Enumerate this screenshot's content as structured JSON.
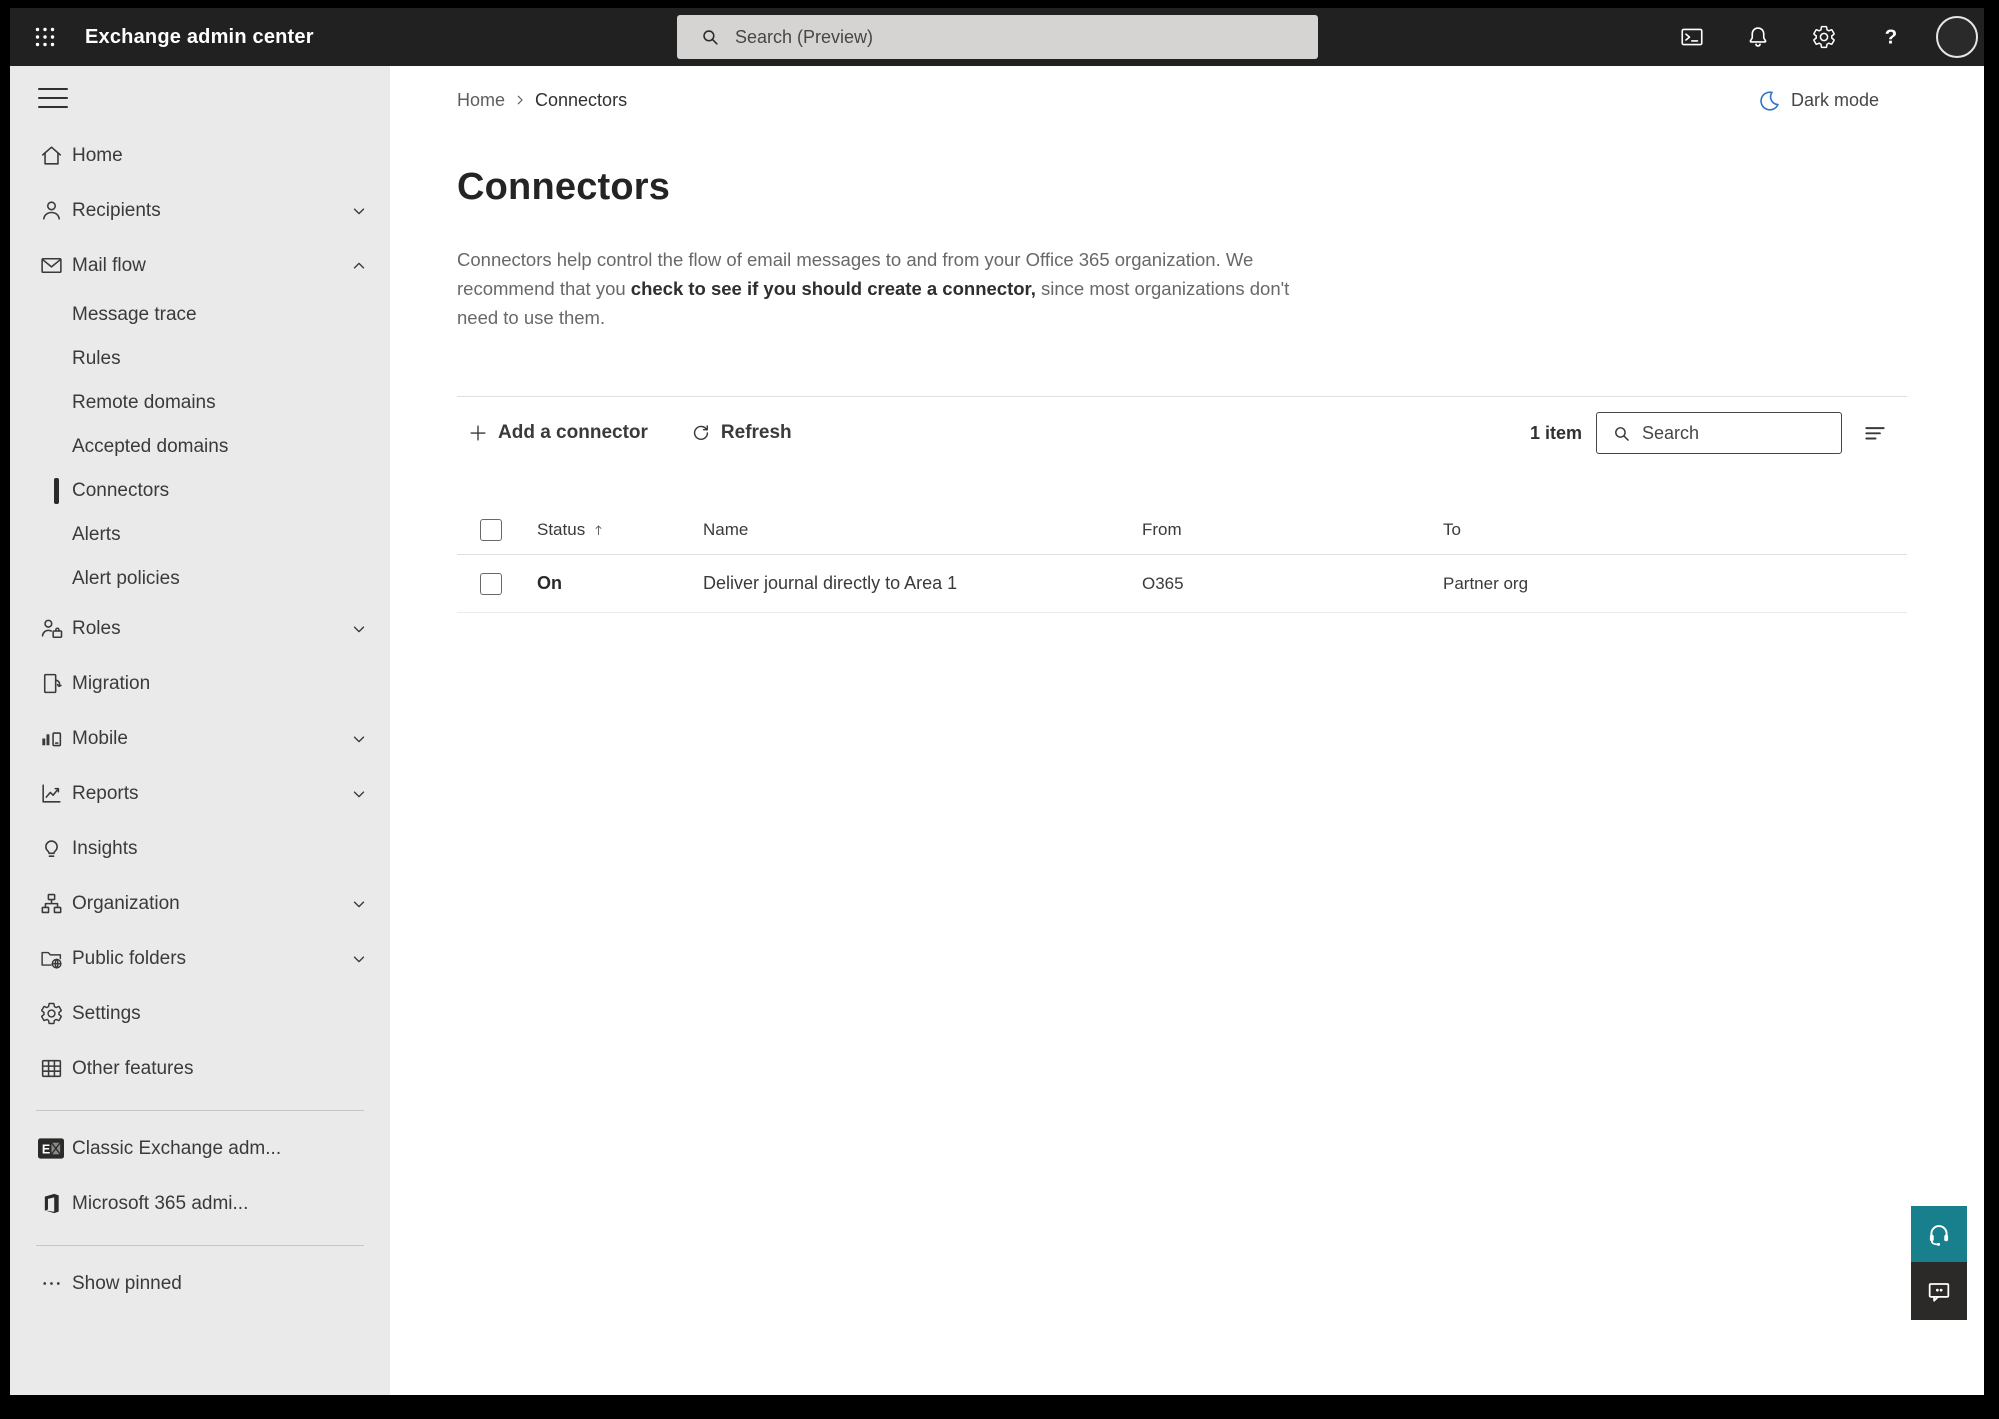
{
  "topbar": {
    "app_title": "Exchange admin center",
    "search_placeholder": "Search (Preview)",
    "icons": [
      "app-launcher",
      "powershell-terminal",
      "notifications-bell",
      "settings-gear",
      "help",
      "account-avatar"
    ]
  },
  "sidebar": {
    "items": [
      {
        "label": "Home",
        "icon": "home-icon"
      },
      {
        "label": "Recipients",
        "icon": "person-icon",
        "chevron": "down"
      },
      {
        "label": "Mail flow",
        "icon": "mail-icon",
        "chevron": "up",
        "expanded": true
      },
      {
        "label": "Message trace",
        "type": "sub"
      },
      {
        "label": "Rules",
        "type": "sub"
      },
      {
        "label": "Remote domains",
        "type": "sub"
      },
      {
        "label": "Accepted domains",
        "type": "sub"
      },
      {
        "label": "Connectors",
        "type": "sub",
        "selected": true
      },
      {
        "label": "Alerts",
        "type": "sub"
      },
      {
        "label": "Alert policies",
        "type": "sub"
      },
      {
        "label": "Roles",
        "icon": "roles-icon",
        "chevron": "down"
      },
      {
        "label": "Migration",
        "icon": "migration-icon"
      },
      {
        "label": "Mobile",
        "icon": "mobile-icon",
        "chevron": "down"
      },
      {
        "label": "Reports",
        "icon": "reports-icon",
        "chevron": "down"
      },
      {
        "label": "Insights",
        "icon": "insights-icon"
      },
      {
        "label": "Organization",
        "icon": "organization-icon",
        "chevron": "down"
      },
      {
        "label": "Public folders",
        "icon": "public-folders-icon",
        "chevron": "down"
      },
      {
        "label": "Settings",
        "icon": "settings-gear-icon"
      },
      {
        "label": "Other features",
        "icon": "other-features-icon"
      }
    ],
    "footer_items": [
      {
        "label": "Classic Exchange adm...",
        "icon": "exchange-logo"
      },
      {
        "label": "Microsoft 365 admi...",
        "icon": "microsoft-365-logo"
      }
    ],
    "show_pinned_label": "Show pinned"
  },
  "breadcrumb": {
    "items": [
      "Home",
      "Connectors"
    ]
  },
  "header": {
    "dark_mode_label": "Dark mode"
  },
  "page": {
    "title": "Connectors",
    "description_pre": "Connectors help control the flow of email messages to and from your Office 365 organization. We recommend that you ",
    "description_link": "check to see if you should create a connector,",
    "description_post": " since most organizations don't need to use them."
  },
  "toolbar": {
    "add_label": "Add a connector",
    "refresh_label": "Refresh",
    "item_count": "1 item",
    "search_placeholder": "Search"
  },
  "table": {
    "columns": [
      "Status",
      "Name",
      "From",
      "To"
    ],
    "sorted_by": "Status",
    "sort_direction": "ascending",
    "rows": [
      {
        "status": "On",
        "name": "Deliver journal directly to Area 1",
        "from": "O365",
        "to": "Partner org"
      }
    ]
  },
  "floating": {
    "help": "headset-help",
    "feedback": "feedback-bubble"
  },
  "colors": {
    "topbar_bg": "#212121",
    "sidebar_bg": "#eaeaea",
    "teal_help": "#17808c",
    "moon_blue": "#3273c6",
    "text_dark": "#323130",
    "text_gray": "#605e5c"
  }
}
